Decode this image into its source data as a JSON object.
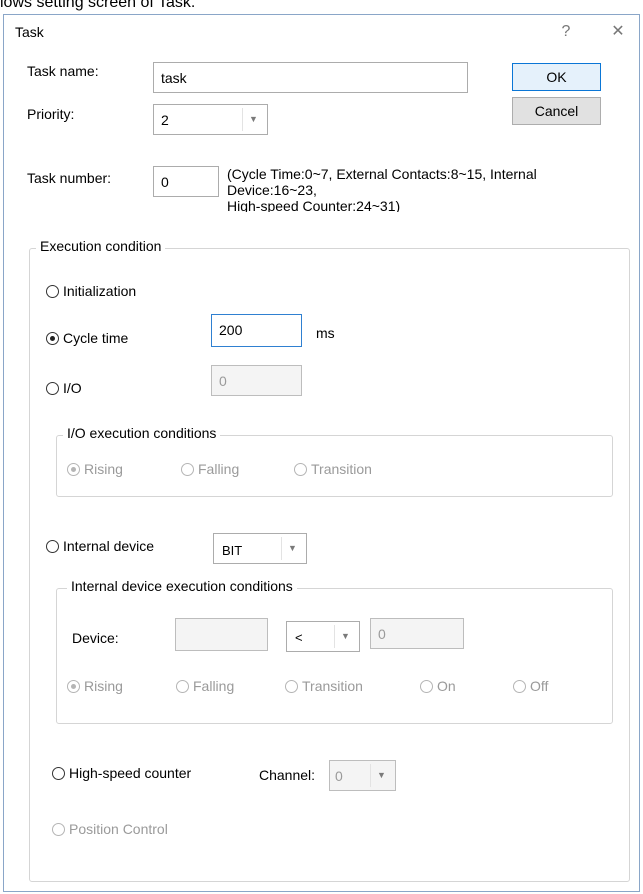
{
  "caption": "lows setting screen of Task.",
  "dialog": {
    "title": "Task",
    "help_icon": "?",
    "close_icon": "✕"
  },
  "task_name": {
    "label": "Task name:",
    "value": "task"
  },
  "priority": {
    "label": "Priority:",
    "value": "2"
  },
  "task_number": {
    "label": "Task number:",
    "value": "0",
    "hint_line1": "(Cycle Time:0~7, External Contacts:8~15, Internal",
    "hint_line2": "Device:16~23,",
    "hint_line3": "High-speed Counter:24~31)"
  },
  "buttons": {
    "ok": "OK",
    "cancel": "Cancel"
  },
  "execution_condition": {
    "title": "Execution condition",
    "initialization": "Initialization",
    "cycle_time": {
      "label": "Cycle time",
      "value": "200",
      "unit": "ms",
      "selected": true
    },
    "io": {
      "label": "I/O",
      "value": "0"
    },
    "io_conditions": {
      "title": "I/O execution conditions",
      "options": [
        "Rising",
        "Falling",
        "Transition"
      ]
    },
    "internal_device": {
      "label": "Internal device",
      "type_value": "BIT"
    },
    "internal_conditions": {
      "title": "Internal device execution conditions",
      "device_label": "Device:",
      "device_value": "",
      "operator": "<",
      "compare_value": "0",
      "options": [
        "Rising",
        "Falling",
        "Transition",
        "On",
        "Off"
      ]
    },
    "high_speed_counter": {
      "label": "High-speed counter",
      "channel_label": "Channel:",
      "channel_value": "0"
    },
    "position_control": "Position Control"
  }
}
